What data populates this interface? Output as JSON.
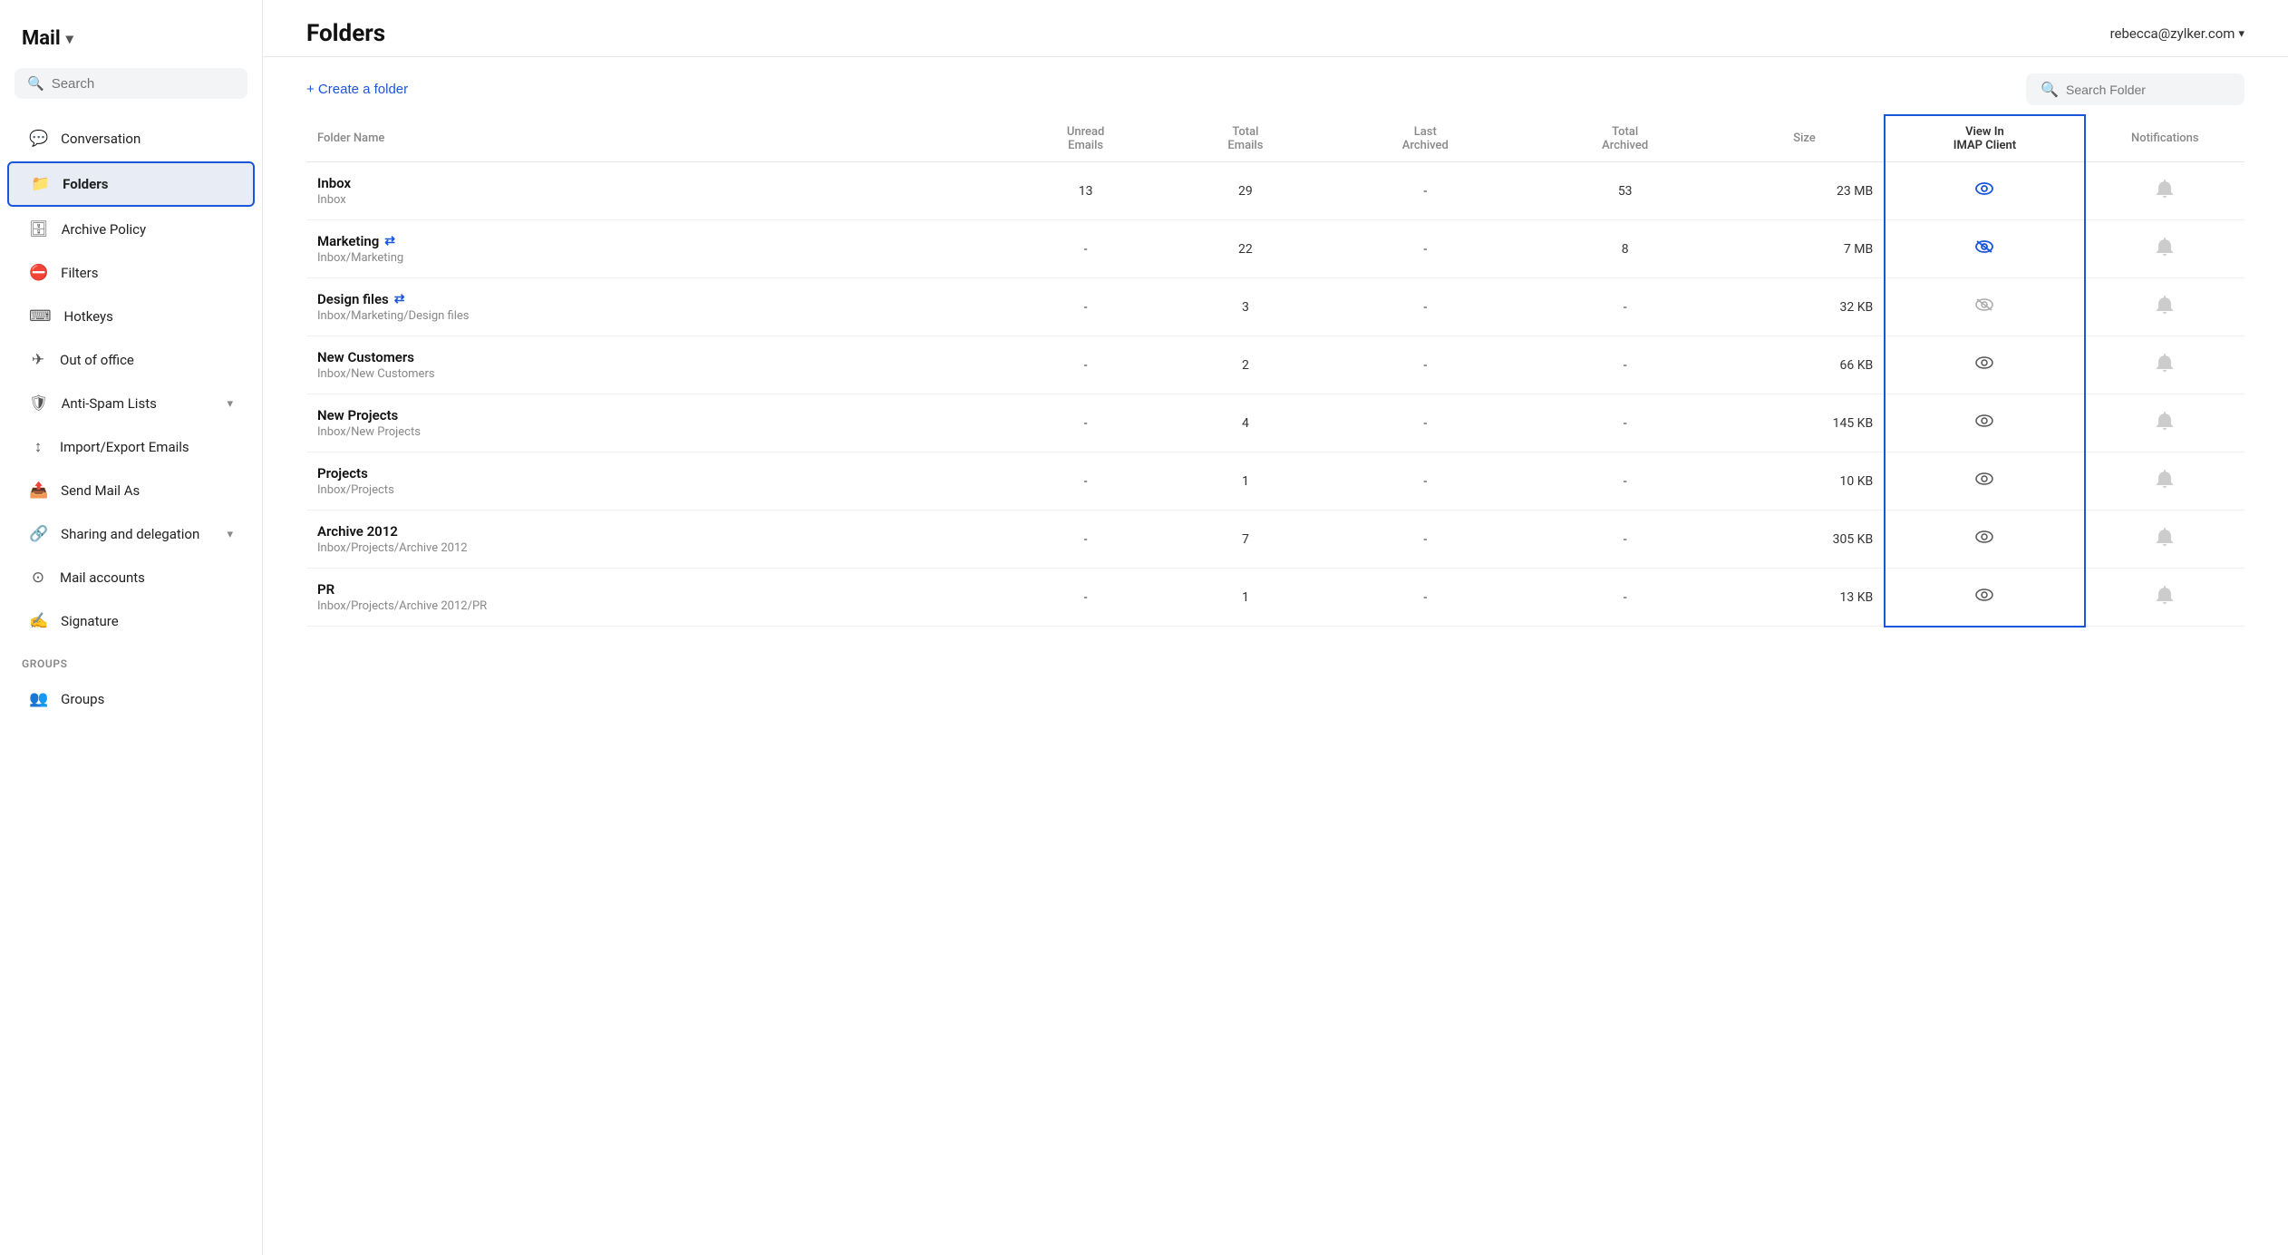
{
  "app": {
    "title": "Mail",
    "title_chevron": "▾"
  },
  "sidebar": {
    "search_placeholder": "Search",
    "items": [
      {
        "id": "conversation",
        "label": "Conversation",
        "icon": "💬",
        "active": false
      },
      {
        "id": "folders",
        "label": "Folders",
        "icon": "📁",
        "active": true
      },
      {
        "id": "archive-policy",
        "label": "Archive Policy",
        "icon": "🗄",
        "active": false
      },
      {
        "id": "filters",
        "label": "Filters",
        "icon": "🔽",
        "active": false
      },
      {
        "id": "hotkeys",
        "label": "Hotkeys",
        "icon": "⌨",
        "active": false
      },
      {
        "id": "out-of-office",
        "label": "Out of office",
        "icon": "✈",
        "active": false
      },
      {
        "id": "anti-spam",
        "label": "Anti-Spam Lists",
        "icon": "🛡",
        "active": false,
        "has_chevron": true
      },
      {
        "id": "import-export",
        "label": "Import/Export Emails",
        "icon": "↕",
        "active": false
      },
      {
        "id": "send-mail-as",
        "label": "Send Mail As",
        "icon": "📤",
        "active": false
      },
      {
        "id": "sharing-delegation",
        "label": "Sharing and delegation",
        "icon": "🔗",
        "active": false,
        "has_chevron": true
      },
      {
        "id": "mail-accounts",
        "label": "Mail accounts",
        "icon": "⊙",
        "active": false
      },
      {
        "id": "signature",
        "label": "Signature",
        "icon": "✍",
        "active": false
      }
    ],
    "groups": [
      {
        "id": "groups",
        "label": "GROUPS",
        "items": [
          {
            "id": "groups-item",
            "label": "Groups",
            "icon": "👥",
            "active": false
          }
        ]
      }
    ]
  },
  "header": {
    "page_title": "Folders",
    "user_email": "rebecca@zylker.com",
    "user_chevron": "▾"
  },
  "toolbar": {
    "create_folder_label": "+ Create a folder",
    "search_folder_placeholder": "Search Folder"
  },
  "table": {
    "columns": [
      {
        "id": "folder-name",
        "label": "Folder Name"
      },
      {
        "id": "unread-emails",
        "label": "Unread\nEmails"
      },
      {
        "id": "total-emails",
        "label": "Total\nEmails"
      },
      {
        "id": "last-archived",
        "label": "Last\nArchived"
      },
      {
        "id": "total-archived",
        "label": "Total\nArchived"
      },
      {
        "id": "size",
        "label": "Size"
      },
      {
        "id": "view-in-imap",
        "label": "View In\nIMAP Client"
      },
      {
        "id": "notifications",
        "label": "Notifications"
      }
    ],
    "rows": [
      {
        "name": "Inbox",
        "path": "Inbox",
        "shared": false,
        "unread": "13",
        "total": "29",
        "last_archived": "-",
        "total_archived": "53",
        "size": "23 MB",
        "imap_visible": true,
        "imap_highlighted": true,
        "imap_strikethrough": false,
        "notif_active": false
      },
      {
        "name": "Marketing",
        "path": "Inbox/Marketing",
        "shared": true,
        "unread": "-",
        "total": "22",
        "last_archived": "-",
        "total_archived": "8",
        "size": "7 MB",
        "imap_visible": false,
        "imap_highlighted": true,
        "imap_strikethrough": true,
        "notif_active": false
      },
      {
        "name": "Design files",
        "path": "Inbox/Marketing/Design files",
        "shared": true,
        "unread": "-",
        "total": "3",
        "last_archived": "-",
        "total_archived": "-",
        "size": "32 KB",
        "imap_visible": false,
        "imap_highlighted": false,
        "imap_strikethrough": true,
        "notif_active": false
      },
      {
        "name": "New Customers",
        "path": "Inbox/New Customers",
        "shared": false,
        "unread": "-",
        "total": "2",
        "last_archived": "-",
        "total_archived": "-",
        "size": "66 KB",
        "imap_visible": true,
        "imap_highlighted": false,
        "imap_strikethrough": false,
        "notif_active": false
      },
      {
        "name": "New Projects",
        "path": "Inbox/New Projects",
        "shared": false,
        "unread": "-",
        "total": "4",
        "last_archived": "-",
        "total_archived": "-",
        "size": "145 KB",
        "imap_visible": true,
        "imap_highlighted": false,
        "imap_strikethrough": false,
        "notif_active": false
      },
      {
        "name": "Projects",
        "path": "Inbox/Projects",
        "shared": false,
        "unread": "-",
        "total": "1",
        "last_archived": "-",
        "total_archived": "-",
        "size": "10 KB",
        "imap_visible": true,
        "imap_highlighted": false,
        "imap_strikethrough": false,
        "notif_active": false
      },
      {
        "name": "Archive 2012",
        "path": "Inbox/Projects/Archive 2012",
        "shared": false,
        "unread": "-",
        "total": "7",
        "last_archived": "-",
        "total_archived": "-",
        "size": "305 KB",
        "imap_visible": true,
        "imap_highlighted": false,
        "imap_strikethrough": false,
        "notif_active": false
      },
      {
        "name": "PR",
        "path": "Inbox/Projects/Archive 2012/PR",
        "shared": false,
        "unread": "-",
        "total": "1",
        "last_archived": "-",
        "total_archived": "-",
        "size": "13 KB",
        "imap_visible": true,
        "imap_highlighted": false,
        "imap_strikethrough": false,
        "notif_active": false,
        "is_last": true
      }
    ]
  },
  "icons": {
    "search": "🔍",
    "eye_visible": "👁",
    "eye_hidden": "🚫",
    "bell": "🔔",
    "bell_off": "🔕",
    "share": "⇄",
    "plus": "+",
    "chevron_down": "▾"
  }
}
